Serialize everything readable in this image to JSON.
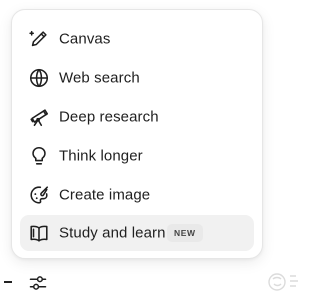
{
  "menu": {
    "items": [
      {
        "label": "Canvas",
        "icon": "canvas-pen-icon"
      },
      {
        "label": "Web search",
        "icon": "globe-icon"
      },
      {
        "label": "Deep research",
        "icon": "telescope-icon"
      },
      {
        "label": "Think longer",
        "icon": "lightbulb-icon"
      },
      {
        "label": "Create image",
        "icon": "palette-icon"
      },
      {
        "label": "Study and learn",
        "icon": "open-book-icon",
        "badge": "NEW",
        "highlighted": true
      }
    ]
  },
  "toolbar": {
    "tools_icon": "sliders-icon"
  },
  "colors": {
    "text": "#1f1f1f",
    "highlight": "#f1f1f1",
    "badge_bg": "#e9e9e9"
  }
}
